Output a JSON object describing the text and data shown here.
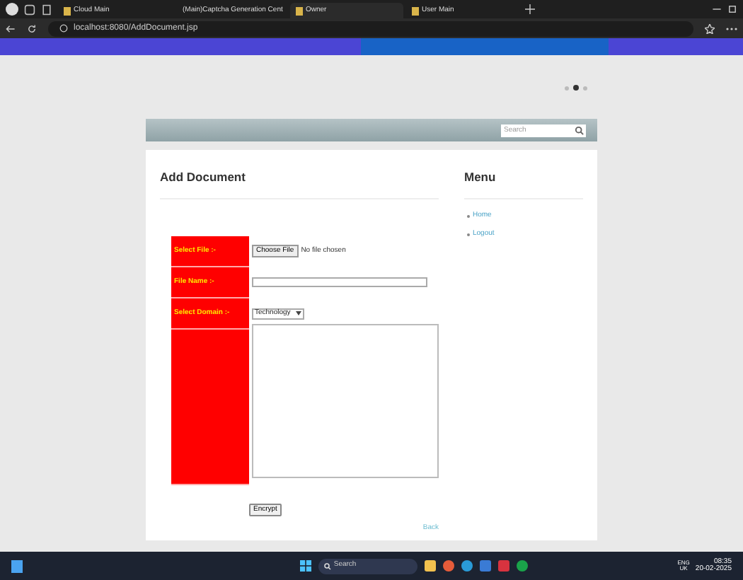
{
  "browser": {
    "tabs": [
      {
        "title": "Cloud Main",
        "selected": false
      },
      {
        "title": "(Main)Captcha Generation Cent",
        "selected": false
      },
      {
        "title": "Owner",
        "selected": true
      },
      {
        "title": "User Main",
        "selected": false
      }
    ],
    "address": "localhost:8080/AddDocument.jsp"
  },
  "page": {
    "slider_dots": [
      {
        "selected": false
      },
      {
        "selected": true
      },
      {
        "selected": false
      }
    ],
    "search": {
      "placeholder": "Search"
    },
    "heading": "Add Document",
    "form": {
      "rows": [
        {
          "label": "Select File :-",
          "kind": "file",
          "button": "Choose File",
          "value": "No file chosen"
        },
        {
          "label": "File Name :-",
          "kind": "text"
        },
        {
          "label": "Select Domain :-",
          "kind": "select",
          "value": "Technology"
        },
        {
          "kind": "textarea"
        }
      ],
      "submit": "Encrypt"
    },
    "back_link": "Back",
    "menu": {
      "title": "Menu",
      "items": [
        "Home",
        "Logout"
      ]
    }
  },
  "taskbar": {
    "search": "Search",
    "language": [
      "ENG",
      "UK"
    ],
    "time": "08:35",
    "date": "20-02-2025"
  }
}
